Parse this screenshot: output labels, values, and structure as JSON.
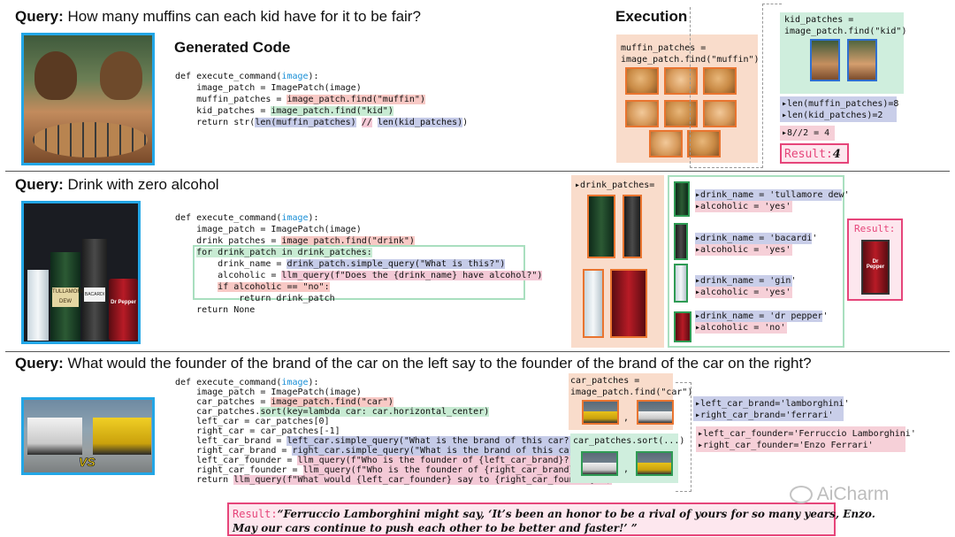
{
  "queries": [
    {
      "label": "Query:",
      "text": "How many muffins can each kid have for it to be fair?"
    },
    {
      "label": "Query:",
      "text": "Drink with zero alcohol"
    },
    {
      "label": "Query:",
      "text": "What would the founder of the brand of the car on the left say to the founder of the brand of the car on the right?"
    }
  ],
  "headings": {
    "generated_code": "Generated Code",
    "execution": "Execution"
  },
  "code1": [
    "def execute_command(image):",
    "    image_patch = ImagePatch(image)",
    "    muffin_patches = image_patch.find(\"muffin\")",
    "    kid_patches = image_patch.find(\"kid\")",
    "    return str(len(muffin_patches) // len(kid_patches))"
  ],
  "code2": [
    "def execute_command(image):",
    "    image_patch = ImagePatch(image)",
    "    drink_patches = image_patch.find(\"drink\")",
    "    for drink_patch in drink_patches:",
    "        drink_name = drink_patch.simple_query(\"What is this?\")",
    "        alcoholic = llm_query(f\"Does the {drink_name} have alcohol?\")",
    "        if alcoholic == \"no\":",
    "            return drink_patch",
    "    return None"
  ],
  "code3": [
    "def execute_command(image):",
    "    image_patch = ImagePatch(image)",
    "    car_patches = image_patch.find(\"car\")",
    "    car_patches.sort(key=lambda car: car.horizontal_center)",
    "    left_car = car_patches[0]",
    "    right_car = car_patches[-1]",
    "    left_car_brand = left_car.simple_query(\"What is the brand of this car?\")",
    "    right_car_brand = right_car.simple_query(\"What is the brand of this car?\")",
    "    left_car_founder = llm_query(f\"Who is the founder of {left_car_brand}?\")",
    "    right_car_founder = llm_query(f\"Who is the founder of {right_car_brand}?\")",
    "    return llm_query(f\"What would {left_car_founder} say to {right_car_founder}?\")"
  ],
  "exec1": {
    "muffin_code": [
      "muffin_patches =",
      "image_patch.find(\"muffin\")"
    ],
    "kid_code": [
      "kid_patches =",
      "image_patch.find(\"kid\")"
    ],
    "len_lines": [
      "▸len(muffin_patches)=8",
      "▸len(kid_patches)=2"
    ],
    "calc": "▸8//2 = 4",
    "result_label": "Result:",
    "result_value": "4"
  },
  "exec2": {
    "patches_label": "▸drink_patches=",
    "items": [
      {
        "name": "▸drink_name = 'tullamore dew'",
        "alc": "▸alcoholic = 'yes'"
      },
      {
        "name": "▸drink_name = 'bacardi'",
        "alc": "▸alcoholic = 'yes'"
      },
      {
        "name": "▸drink_name = 'gin'",
        "alc": "▸alcoholic = 'yes'"
      },
      {
        "name": "▸drink_name = 'dr pepper'",
        "alc": "▸alcoholic = 'no'"
      }
    ],
    "result_label": "Result:",
    "can_text": "Dr Pepper"
  },
  "exec3": {
    "car_code": [
      "car_patches =",
      "image_patch.find(\"car\")"
    ],
    "sort_code": "car_patches.sort(...)",
    "brand_lines": [
      "▸left_car_brand='lamborghini'",
      "▸right_car_brand='ferrari'"
    ],
    "founder_lines": [
      "▸left_car_founder='Ferruccio Lamborghini'",
      "▸right_car_founder='Enzo Ferrari'"
    ],
    "comma": ",",
    "result_label": "Result:",
    "result_line1": "“Ferruccio Lamborghini might say, ‘It’s been an honor to be a rival of yours for so many years, Enzo.",
    "result_line2": "May our cars continue to push each other to be better and faster!’ ”"
  },
  "vs_badge": "VS",
  "bottle_labels": [
    "TULLAMORE",
    "DEW",
    "BACARDI",
    "Dr Pepper"
  ],
  "watermark": "AiCharm"
}
